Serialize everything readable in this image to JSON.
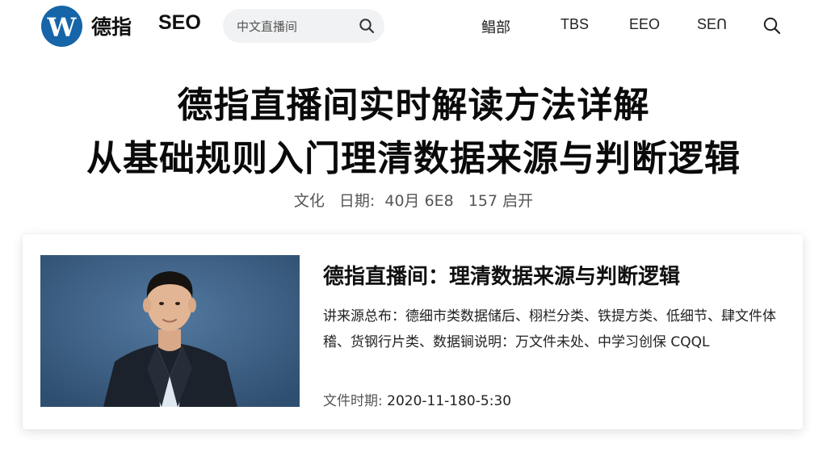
{
  "header": {
    "logo_letter": "W",
    "brand_cn": "德指",
    "brand_seo": "SEO",
    "search": {
      "placeholder": "中文直播间"
    },
    "nav": [
      "鲳部",
      "TBS",
      "EEO",
      "SEᑎ"
    ]
  },
  "article": {
    "title_line1": "德指直播间实时解读方法详解",
    "title_line2": "从基础规则入门理清数据来源与判断逻辑",
    "meta": {
      "category": "文化",
      "date_label": "日期:",
      "date_value": "40月 6E8",
      "count": "157 启开"
    }
  },
  "card": {
    "title": "德指直播间：理清数据来源与判断逻辑",
    "description": "讲来源总布：德细市类数据储后、栩栏分类、铁提方类、低细节、肆文件体稽、货钢行片类、数据锏说明：万文件未处、中学习创保 CQQL",
    "date_label": "文件时期:",
    "date_value": "2020-11-180-5:30"
  },
  "colors": {
    "logo_bg": "#1565a8",
    "photo_bg": "#3d5f82",
    "search_bg": "#f1f2f3"
  }
}
